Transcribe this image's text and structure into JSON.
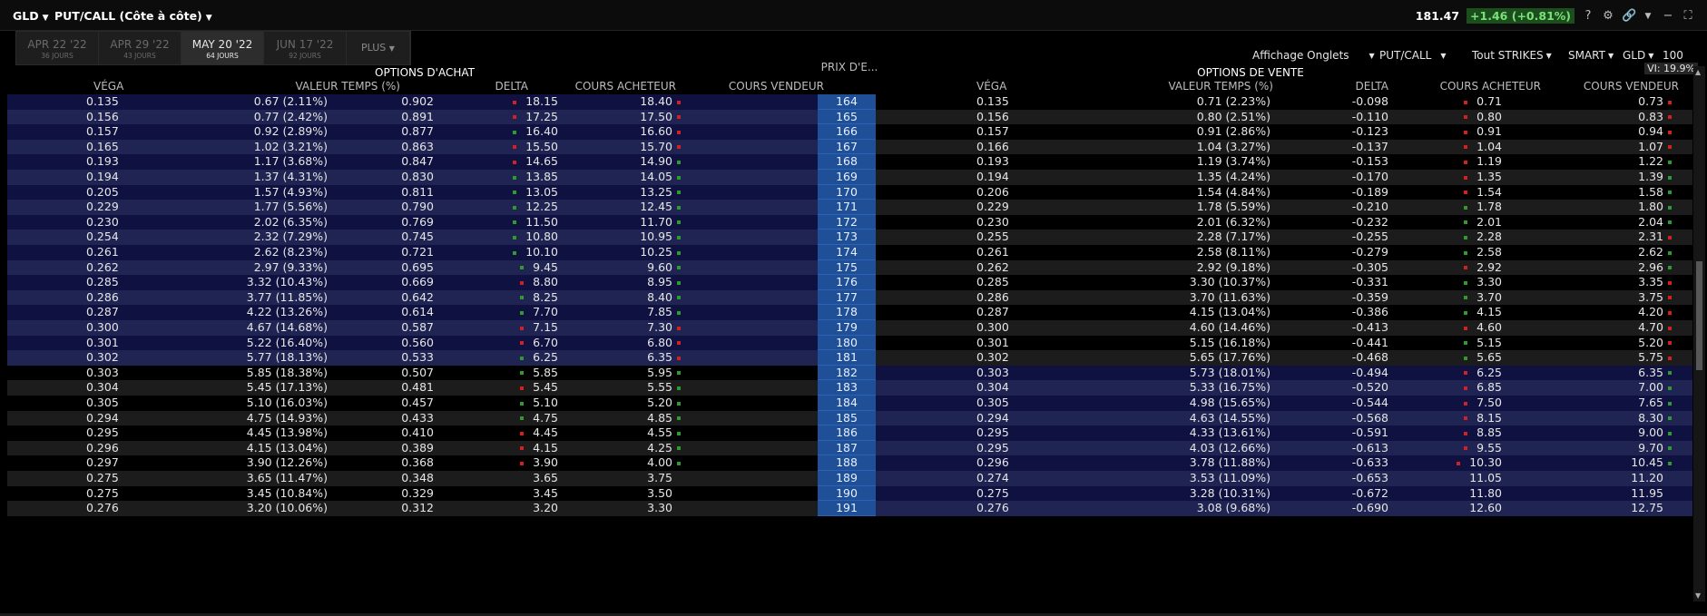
{
  "header": {
    "symbol": "GLD",
    "mode": "PUT/CALL (Côte à côte)",
    "price": "181.47",
    "change": "+1.46",
    "change_pct": "(+0.81%)",
    "help": "?"
  },
  "tabs": [
    {
      "label": "APR 22 '22",
      "sub": "36 JOURS",
      "active": false
    },
    {
      "label": "APR 29 '22",
      "sub": "43 JOURS",
      "active": false
    },
    {
      "label": "MAY 20 '22",
      "sub": "64 JOURS",
      "active": true
    },
    {
      "label": "JUN 17 '22",
      "sub": "92 JOURS",
      "active": false
    }
  ],
  "plus_tab": "PLUS",
  "controls": {
    "affichage": "Affichage Onglets",
    "putcall": "PUT/CALL",
    "strikes": "Tout STRIKES",
    "route": "SMART",
    "ticker": "GLD",
    "count": "100",
    "vi": "VI: 19.9%"
  },
  "sections": {
    "calls": "OPTIONS D'ACHAT",
    "puts": "OPTIONS DE VENTE"
  },
  "columns": {
    "vega": "VÉGA",
    "time_value": "VALEUR TEMPS (%)",
    "delta": "DELTA",
    "bid": "COURS ACHETEUR",
    "ask": "COURS VENDEUR",
    "strike": "PRIX D'E..."
  },
  "colors": {
    "itm_row_a": "#0f1140",
    "itm_row_b": "#1f2452",
    "otm_row_a": "#000000",
    "otm_row_b": "#1c1c1c",
    "strike_bg": "#1e4f97",
    "tick_up": "#2f9a2f",
    "tick_down": "#d42020"
  },
  "rows": [
    {
      "strike": "164",
      "call": {
        "vega": "0.135",
        "tv": "0.67 (2.11%)",
        "delta": "0.902",
        "bid": "18.15",
        "ask": "18.40",
        "bm": "d",
        "am": "d"
      },
      "put": {
        "vega": "0.135",
        "tv": "0.71 (2.23%)",
        "delta": "-0.098",
        "bid": "0.71",
        "ask": "0.73",
        "bm": "d",
        "am": "d"
      }
    },
    {
      "strike": "165",
      "call": {
        "vega": "0.156",
        "tv": "0.77 (2.42%)",
        "delta": "0.891",
        "bid": "17.25",
        "ask": "17.50",
        "bm": "d",
        "am": "d"
      },
      "put": {
        "vega": "0.156",
        "tv": "0.80 (2.51%)",
        "delta": "-0.110",
        "bid": "0.80",
        "ask": "0.83",
        "bm": "d",
        "am": "d"
      }
    },
    {
      "strike": "166",
      "call": {
        "vega": "0.157",
        "tv": "0.92 (2.89%)",
        "delta": "0.877",
        "bid": "16.40",
        "ask": "16.60",
        "bm": "u",
        "am": "d"
      },
      "put": {
        "vega": "0.157",
        "tv": "0.91 (2.86%)",
        "delta": "-0.123",
        "bid": "0.91",
        "ask": "0.94",
        "bm": "d",
        "am": "d"
      }
    },
    {
      "strike": "167",
      "call": {
        "vega": "0.165",
        "tv": "1.02 (3.21%)",
        "delta": "0.863",
        "bid": "15.50",
        "ask": "15.70",
        "bm": "d",
        "am": "d"
      },
      "put": {
        "vega": "0.166",
        "tv": "1.04 (3.27%)",
        "delta": "-0.137",
        "bid": "1.04",
        "ask": "1.07",
        "bm": "d",
        "am": "d"
      }
    },
    {
      "strike": "168",
      "call": {
        "vega": "0.193",
        "tv": "1.17 (3.68%)",
        "delta": "0.847",
        "bid": "14.65",
        "ask": "14.90",
        "bm": "d",
        "am": "u"
      },
      "put": {
        "vega": "0.193",
        "tv": "1.19 (3.74%)",
        "delta": "-0.153",
        "bid": "1.19",
        "ask": "1.22",
        "bm": "d",
        "am": "u"
      }
    },
    {
      "strike": "169",
      "call": {
        "vega": "0.194",
        "tv": "1.37 (4.31%)",
        "delta": "0.830",
        "bid": "13.85",
        "ask": "14.05",
        "bm": "u",
        "am": "u"
      },
      "put": {
        "vega": "0.194",
        "tv": "1.35 (4.24%)",
        "delta": "-0.170",
        "bid": "1.35",
        "ask": "1.39",
        "bm": "d",
        "am": "u"
      }
    },
    {
      "strike": "170",
      "call": {
        "vega": "0.205",
        "tv": "1.57 (4.93%)",
        "delta": "0.811",
        "bid": "13.05",
        "ask": "13.25",
        "bm": "u",
        "am": "u"
      },
      "put": {
        "vega": "0.206",
        "tv": "1.54 (4.84%)",
        "delta": "-0.189",
        "bid": "1.54",
        "ask": "1.58",
        "bm": "d",
        "am": "u"
      }
    },
    {
      "strike": "171",
      "call": {
        "vega": "0.229",
        "tv": "1.77 (5.56%)",
        "delta": "0.790",
        "bid": "12.25",
        "ask": "12.45",
        "bm": "u",
        "am": "u"
      },
      "put": {
        "vega": "0.229",
        "tv": "1.78 (5.59%)",
        "delta": "-0.210",
        "bid": "1.78",
        "ask": "1.80",
        "bm": "u",
        "am": "u"
      }
    },
    {
      "strike": "172",
      "call": {
        "vega": "0.230",
        "tv": "2.02 (6.35%)",
        "delta": "0.769",
        "bid": "11.50",
        "ask": "11.70",
        "bm": "u",
        "am": "u"
      },
      "put": {
        "vega": "0.230",
        "tv": "2.01 (6.32%)",
        "delta": "-0.232",
        "bid": "2.01",
        "ask": "2.04",
        "bm": "u",
        "am": "u"
      }
    },
    {
      "strike": "173",
      "call": {
        "vega": "0.254",
        "tv": "2.32 (7.29%)",
        "delta": "0.745",
        "bid": "10.80",
        "ask": "10.95",
        "bm": "u",
        "am": "u"
      },
      "put": {
        "vega": "0.255",
        "tv": "2.28 (7.17%)",
        "delta": "-0.255",
        "bid": "2.28",
        "ask": "2.31",
        "bm": "u",
        "am": "d"
      }
    },
    {
      "strike": "174",
      "call": {
        "vega": "0.261",
        "tv": "2.62 (8.23%)",
        "delta": "0.721",
        "bid": "10.10",
        "ask": "10.25",
        "bm": "u",
        "am": "u"
      },
      "put": {
        "vega": "0.261",
        "tv": "2.58 (8.11%)",
        "delta": "-0.279",
        "bid": "2.58",
        "ask": "2.62",
        "bm": "u",
        "am": "u"
      }
    },
    {
      "strike": "175",
      "call": {
        "vega": "0.262",
        "tv": "2.97 (9.33%)",
        "delta": "0.695",
        "bid": "9.45",
        "ask": "9.60",
        "bm": "u",
        "am": "u"
      },
      "put": {
        "vega": "0.262",
        "tv": "2.92 (9.18%)",
        "delta": "-0.305",
        "bid": "2.92",
        "ask": "2.96",
        "bm": "d",
        "am": "u"
      }
    },
    {
      "strike": "176",
      "call": {
        "vega": "0.285",
        "tv": "3.32 (10.43%)",
        "delta": "0.669",
        "bid": "8.80",
        "ask": "8.95",
        "bm": "d",
        "am": "u"
      },
      "put": {
        "vega": "0.285",
        "tv": "3.30 (10.37%)",
        "delta": "-0.331",
        "bid": "3.30",
        "ask": "3.35",
        "bm": "u",
        "am": "d"
      }
    },
    {
      "strike": "177",
      "call": {
        "vega": "0.286",
        "tv": "3.77 (11.85%)",
        "delta": "0.642",
        "bid": "8.25",
        "ask": "8.40",
        "bm": "u",
        "am": "u"
      },
      "put": {
        "vega": "0.286",
        "tv": "3.70 (11.63%)",
        "delta": "-0.359",
        "bid": "3.70",
        "ask": "3.75",
        "bm": "u",
        "am": "d"
      }
    },
    {
      "strike": "178",
      "call": {
        "vega": "0.287",
        "tv": "4.22 (13.26%)",
        "delta": "0.614",
        "bid": "7.70",
        "ask": "7.85",
        "bm": "u",
        "am": "u"
      },
      "put": {
        "vega": "0.287",
        "tv": "4.15 (13.04%)",
        "delta": "-0.386",
        "bid": "4.15",
        "ask": "4.20",
        "bm": "u",
        "am": "d"
      }
    },
    {
      "strike": "179",
      "call": {
        "vega": "0.300",
        "tv": "4.67 (14.68%)",
        "delta": "0.587",
        "bid": "7.15",
        "ask": "7.30",
        "bm": "d",
        "am": "d"
      },
      "put": {
        "vega": "0.300",
        "tv": "4.60 (14.46%)",
        "delta": "-0.413",
        "bid": "4.60",
        "ask": "4.70",
        "bm": "d",
        "am": "d"
      }
    },
    {
      "strike": "180",
      "call": {
        "vega": "0.301",
        "tv": "5.22 (16.40%)",
        "delta": "0.560",
        "bid": "6.70",
        "ask": "6.80",
        "bm": "d",
        "am": "d"
      },
      "put": {
        "vega": "0.301",
        "tv": "5.15 (16.18%)",
        "delta": "-0.441",
        "bid": "5.15",
        "ask": "5.20",
        "bm": "u",
        "am": "d"
      }
    },
    {
      "strike": "181",
      "call": {
        "vega": "0.302",
        "tv": "5.77 (18.13%)",
        "delta": "0.533",
        "bid": "6.25",
        "ask": "6.35",
        "bm": "u",
        "am": "d"
      },
      "put": {
        "vega": "0.302",
        "tv": "5.65 (17.76%)",
        "delta": "-0.468",
        "bid": "5.65",
        "ask": "5.75",
        "bm": "u",
        "am": "d"
      }
    },
    {
      "strike": "182",
      "call": {
        "vega": "0.303",
        "tv": "5.85 (18.38%)",
        "delta": "0.507",
        "bid": "5.85",
        "ask": "5.95",
        "bm": "u",
        "am": "u"
      },
      "put": {
        "vega": "0.303",
        "tv": "5.73 (18.01%)",
        "delta": "-0.494",
        "bid": "6.25",
        "ask": "6.35",
        "bm": "d",
        "am": "u"
      }
    },
    {
      "strike": "183",
      "call": {
        "vega": "0.304",
        "tv": "5.45 (17.13%)",
        "delta": "0.481",
        "bid": "5.45",
        "ask": "5.55",
        "bm": "d",
        "am": "u"
      },
      "put": {
        "vega": "0.304",
        "tv": "5.33 (16.75%)",
        "delta": "-0.520",
        "bid": "6.85",
        "ask": "7.00",
        "bm": "d",
        "am": "u"
      }
    },
    {
      "strike": "184",
      "call": {
        "vega": "0.305",
        "tv": "5.10 (16.03%)",
        "delta": "0.457",
        "bid": "5.10",
        "ask": "5.20",
        "bm": "u",
        "am": "u"
      },
      "put": {
        "vega": "0.305",
        "tv": "4.98 (15.65%)",
        "delta": "-0.544",
        "bid": "7.50",
        "ask": "7.65",
        "bm": "d",
        "am": "u"
      }
    },
    {
      "strike": "185",
      "call": {
        "vega": "0.294",
        "tv": "4.75 (14.93%)",
        "delta": "0.433",
        "bid": "4.75",
        "ask": "4.85",
        "bm": "u",
        "am": "u"
      },
      "put": {
        "vega": "0.294",
        "tv": "4.63 (14.55%)",
        "delta": "-0.568",
        "bid": "8.15",
        "ask": "8.30",
        "bm": "d",
        "am": "u"
      }
    },
    {
      "strike": "186",
      "call": {
        "vega": "0.295",
        "tv": "4.45 (13.98%)",
        "delta": "0.410",
        "bid": "4.45",
        "ask": "4.55",
        "bm": "d",
        "am": "u"
      },
      "put": {
        "vega": "0.295",
        "tv": "4.33 (13.61%)",
        "delta": "-0.591",
        "bid": "8.85",
        "ask": "9.00",
        "bm": "d",
        "am": "u"
      }
    },
    {
      "strike": "187",
      "call": {
        "vega": "0.296",
        "tv": "4.15 (13.04%)",
        "delta": "0.389",
        "bid": "4.15",
        "ask": "4.25",
        "bm": "d",
        "am": "u"
      },
      "put": {
        "vega": "0.295",
        "tv": "4.03 (12.66%)",
        "delta": "-0.613",
        "bid": "9.55",
        "ask": "9.70",
        "bm": "d",
        "am": "u"
      }
    },
    {
      "strike": "188",
      "call": {
        "vega": "0.297",
        "tv": "3.90 (12.26%)",
        "delta": "0.368",
        "bid": "3.90",
        "ask": "4.00",
        "bm": "d",
        "am": "u"
      },
      "put": {
        "vega": "0.296",
        "tv": "3.78 (11.88%)",
        "delta": "-0.633",
        "bid": "10.30",
        "ask": "10.45",
        "bm": "d",
        "am": "u"
      }
    },
    {
      "strike": "189",
      "call": {
        "vega": "0.275",
        "tv": "3.65 (11.47%)",
        "delta": "0.348",
        "bid": "3.65",
        "ask": "3.75",
        "bm": "",
        "am": ""
      },
      "put": {
        "vega": "0.274",
        "tv": "3.53 (11.09%)",
        "delta": "-0.653",
        "bid": "11.05",
        "ask": "11.20",
        "bm": "",
        "am": ""
      }
    },
    {
      "strike": "190",
      "call": {
        "vega": "0.275",
        "tv": "3.45 (10.84%)",
        "delta": "0.329",
        "bid": "3.45",
        "ask": "3.50",
        "bm": "",
        "am": ""
      },
      "put": {
        "vega": "0.275",
        "tv": "3.28 (10.31%)",
        "delta": "-0.672",
        "bid": "11.80",
        "ask": "11.95",
        "bm": "",
        "am": ""
      }
    },
    {
      "strike": "191",
      "call": {
        "vega": "0.276",
        "tv": "3.20 (10.06%)",
        "delta": "0.312",
        "bid": "3.20",
        "ask": "3.30",
        "bm": "",
        "am": ""
      },
      "put": {
        "vega": "0.276",
        "tv": "3.08 (9.68%)",
        "delta": "-0.690",
        "bid": "12.60",
        "ask": "12.75",
        "bm": "",
        "am": ""
      }
    }
  ]
}
